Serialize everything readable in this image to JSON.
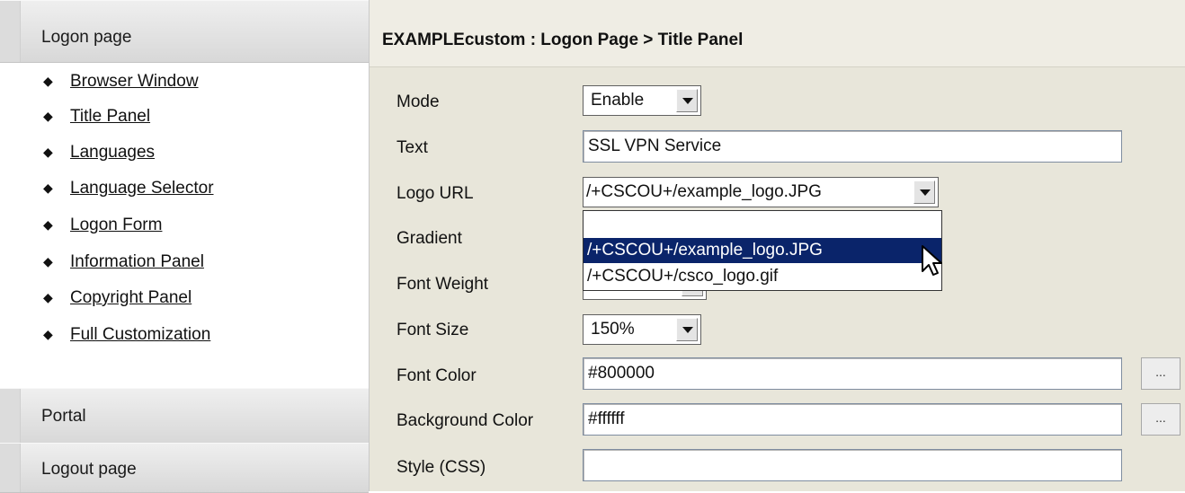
{
  "sidebar": {
    "logon_header": "Logon page",
    "items": [
      {
        "label": "Browser Window"
      },
      {
        "label": "Title Panel"
      },
      {
        "label": "Languages"
      },
      {
        "label": "Language Selector"
      },
      {
        "label": "Logon Form"
      },
      {
        "label": "Information Panel"
      },
      {
        "label": "Copyright Panel"
      },
      {
        "label": "Full Customization"
      }
    ],
    "portal_header": "Portal",
    "logout_header": "Logout page"
  },
  "main": {
    "title": "EXAMPLEcustom : Logon Page > Title Panel",
    "fields": {
      "mode": {
        "label": "Mode",
        "value": "Enable"
      },
      "text": {
        "label": "Text",
        "value": "SSL VPN Service"
      },
      "logo_url": {
        "label": "Logo URL",
        "value": "/+CSCOU+/example_logo.JPG"
      },
      "gradient": {
        "label": "Gradient"
      },
      "font_weight": {
        "label": "Font Weight"
      },
      "font_size": {
        "label": "Font Size",
        "value": "150%"
      },
      "font_color": {
        "label": "Font Color",
        "value": "#800000",
        "button": "..."
      },
      "background_color": {
        "label": "Background Color",
        "value": "#ffffff",
        "button": "..."
      },
      "style_css": {
        "label": "Style (CSS)",
        "value": ""
      }
    },
    "logo_dropdown": {
      "options": [
        "",
        "/+CSCOU+/example_logo.JPG",
        "/+CSCOU+/csco_logo.gif"
      ],
      "highlighted": "/+CSCOU+/example_logo.JPG"
    }
  },
  "colors": {
    "selection": "#0a246a",
    "panel_bg": "#e8e6da"
  }
}
